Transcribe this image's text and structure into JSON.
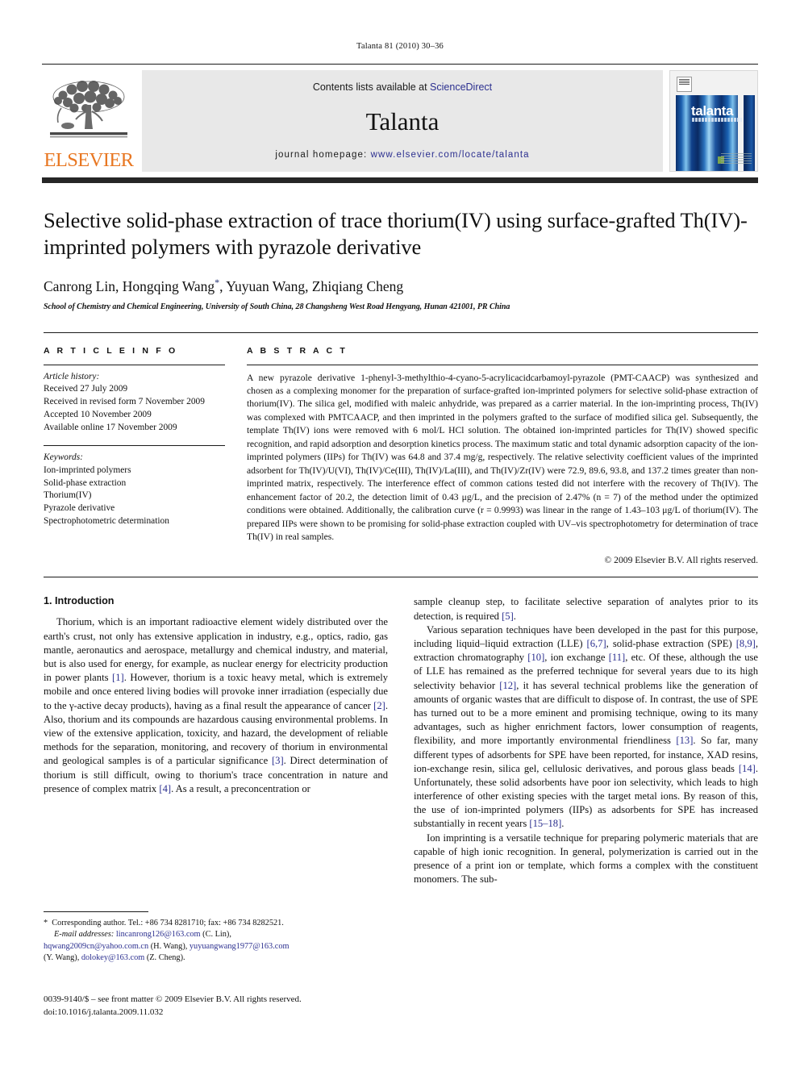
{
  "running_head": "Talanta 81 (2010) 30–36",
  "masthead": {
    "publisher_logo_text": "ELSEVIER",
    "contents_prefix": "Contents lists available at ",
    "contents_link": "ScienceDirect",
    "journal_name": "Talanta",
    "homepage_prefix": "journal homepage: ",
    "homepage_url": "www.elsevier.com/locate/talanta",
    "cover_title": "talanta",
    "link_color": "#2b2f8f",
    "elsevier_orange": "#E87722"
  },
  "article": {
    "title": "Selective solid-phase extraction of trace thorium(IV) using surface-grafted Th(IV)-imprinted polymers with pyrazole derivative",
    "authors": "Canrong Lin, Hongqing Wang",
    "authors_tail": ", Yuyuan Wang, Zhiqiang Cheng",
    "corresponding_marker": "*",
    "affiliation": "School of Chemistry and Chemical Engineering, University of South China, 28 Changsheng West Road Hengyang, Hunan 421001, PR China"
  },
  "info": {
    "heading": "A R T I C L E   I N F O",
    "history_label": "Article history:",
    "history": [
      "Received 27 July 2009",
      "Received in revised form 7 November 2009",
      "Accepted 10 November 2009",
      "Available online 17 November 2009"
    ],
    "keywords_label": "Keywords:",
    "keywords": [
      "Ion-imprinted polymers",
      "Solid-phase extraction",
      "Thorium(IV)",
      "Pyrazole derivative",
      "Spectrophotometric determination"
    ]
  },
  "abstract": {
    "heading": "A B S T R A C T",
    "text": "A new pyrazole derivative 1-phenyl-3-methylthio-4-cyano-5-acrylicacidcarbamoyl-pyrazole (PMT-CAACP) was synthesized and chosen as a complexing monomer for the preparation of surface-grafted ion-imprinted polymers for selective solid-phase extraction of thorium(IV). The silica gel, modified with maleic anhydride, was prepared as a carrier material. In the ion-imprinting process, Th(IV) was complexed with PMTCAACP, and then imprinted in the polymers grafted to the surface of modified silica gel. Subsequently, the template Th(IV) ions were removed with 6 mol/L HCl solution. The obtained ion-imprinted particles for Th(IV) showed specific recognition, and rapid adsorption and desorption kinetics process. The maximum static and total dynamic adsorption capacity of the ion-imprinted polymers (IIPs) for Th(IV) was 64.8 and 37.4 mg/g, respectively. The relative selectivity coefficient values of the imprinted adsorbent for Th(IV)/U(VI), Th(IV)/Ce(III), Th(IV)/La(III), and Th(IV)/Zr(IV) were 72.9, 89.6, 93.8, and 137.2 times greater than non-imprinted matrix, respectively. The interference effect of common cations tested did not interfere with the recovery of Th(IV). The enhancement factor of 20.2, the detection limit of 0.43 μg/L, and the precision of 2.47% (n = 7) of the method under the optimized conditions were obtained. Additionally, the calibration curve (r = 0.9993) was linear in the range of 1.43–103 μg/L of thorium(IV). The prepared IIPs were shown to be promising for solid-phase extraction coupled with UV–vis spectrophotometry for determination of trace Th(IV) in real samples.",
    "copyright": "© 2009 Elsevier B.V. All rights reserved."
  },
  "body": {
    "section_title": "1.  Introduction",
    "left_paragraphs": [
      "Thorium, which is an important radioactive element widely distributed over the earth's crust, not only has extensive application in industry, e.g., optics, radio, gas mantle, aeronautics and aerospace, metallurgy and chemical industry, and material, but is also used for energy, for example, as nuclear energy for electricity production in power plants [1]. However, thorium is a toxic heavy metal, which is extremely mobile and once entered living bodies will provoke inner irradiation (especially due to the γ-active decay products), having as a final result the appearance of cancer [2]. Also, thorium and its compounds are hazardous causing environmental problems. In view of the extensive application, toxicity, and hazard, the development of reliable methods for the separation, monitoring, and recovery of thorium in environmental and geological samples is of a particular significance [3]. Direct determination of thorium is still difficult, owing to thorium's trace concentration in nature and presence of complex matrix [4]. As a result, a preconcentration or"
    ],
    "right_paragraphs": [
      "sample cleanup step, to facilitate selective separation of analytes prior to its detection, is required [5].",
      "Various separation techniques have been developed in the past for this purpose, including liquid–liquid extraction (LLE) [6,7], solid-phase extraction (SPE) [8,9], extraction chromatography [10], ion exchange [11], etc. Of these, although the use of LLE has remained as the preferred technique for several years due to its high selectivity behavior [12], it has several technical problems like the generation of amounts of organic wastes that are difficult to dispose of. In contrast, the use of SPE has turned out to be a more eminent and promising technique, owing to its many advantages, such as higher enrichment factors, lower consumption of reagents, flexibility, and more importantly environmental friendliness [13]. So far, many different types of adsorbents for SPE have been reported, for instance, XAD resins, ion-exchange resin, silica gel, cellulosic derivatives, and porous glass beads [14]. Unfortunately, these solid adsorbents have poor ion selectivity, which leads to high interference of other existing species with the target metal ions. By reason of this, the use of ion-imprinted polymers (IIPs) as adsorbents for SPE has increased substantially in recent years [15–18].",
      "Ion imprinting is a versatile technique for preparing polymeric materials that are capable of high ionic recognition. In general, polymerization is carried out in the presence of a print ion or template, which forms a complex with the constituent monomers. The sub-"
    ]
  },
  "footnotes": {
    "corresponding": "Corresponding author. Tel.: +86 734 8281710; fax: +86 734 8282521.",
    "email_label": "E-mail addresses:",
    "email1": "lincanrong126@163.com",
    "email1_owner": "(C. Lin),",
    "email2": "hqwang2009cn@yahoo.com.cn",
    "email2_owner": "(H. Wang),",
    "email3": "yuyuangwang1977@163.com",
    "email3_owner": "(Y. Wang),",
    "email4": "dolokey@163.com",
    "email4_owner": "(Z. Cheng)."
  },
  "imprint": {
    "issn_line": "0039-9140/$ – see front matter © 2009 Elsevier B.V. All rights reserved.",
    "doi_line": "doi:10.1016/j.talanta.2009.11.032"
  }
}
